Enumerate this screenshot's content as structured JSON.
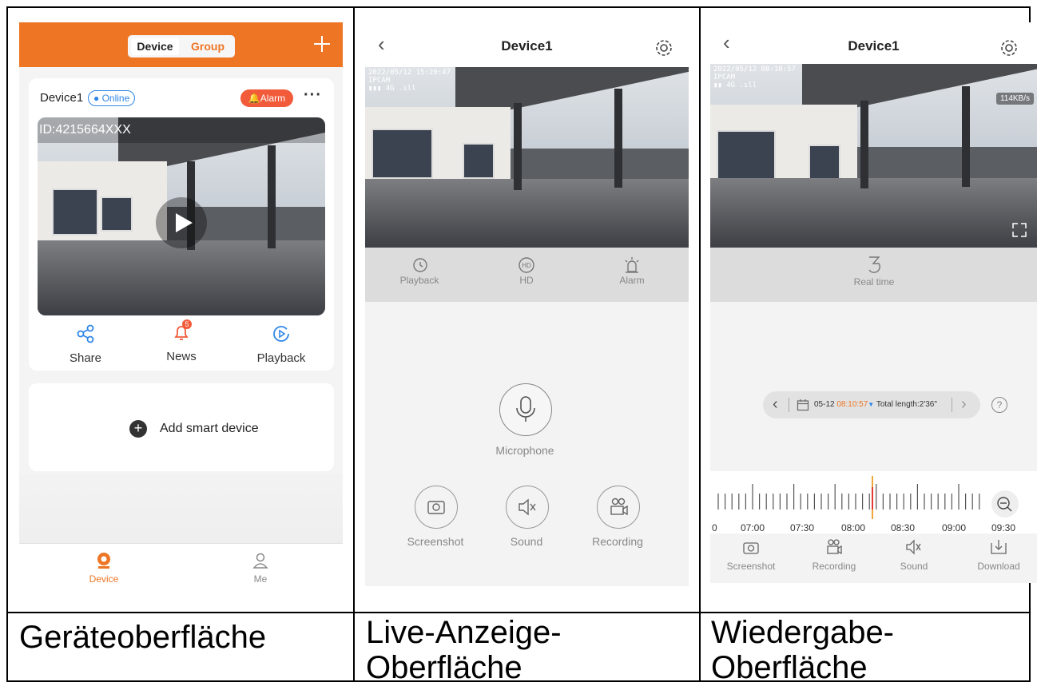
{
  "panel1": {
    "tabs": [
      "Device",
      "Group"
    ],
    "add_icon": "plus-icon",
    "device_name": "Device1",
    "status": "Online",
    "alarm_label": "Alarm",
    "more_icon": "more-icon",
    "device_id": "ID:4215664XXX",
    "actions": [
      {
        "label": "Share",
        "icon": "share-icon"
      },
      {
        "label": "News",
        "icon": "bell-icon",
        "badge": "5"
      },
      {
        "label": "Playback",
        "icon": "playback-icon"
      }
    ],
    "add_device_label": "Add smart device",
    "bottom_nav": [
      {
        "label": "Device",
        "icon": "camera-icon",
        "active": true
      },
      {
        "label": "Me",
        "icon": "user-icon",
        "active": false
      }
    ],
    "accent": "#ee7524"
  },
  "panel2": {
    "title": "Device1",
    "osd_time": "2022/05/12 15:20:47",
    "osd_name": "IPCAM",
    "osd_net": "4G",
    "controls": [
      {
        "label": "Playback",
        "icon": "history-icon"
      },
      {
        "label": "HD",
        "icon": "hd-icon"
      },
      {
        "label": "Alarm",
        "icon": "alarm-light-icon"
      }
    ],
    "microphone_label": "Microphone",
    "bottom": [
      {
        "label": "Screenshot",
        "icon": "camera-icon"
      },
      {
        "label": "Sound",
        "icon": "speaker-mute-icon"
      },
      {
        "label": "Recording",
        "icon": "video-record-icon"
      }
    ]
  },
  "panel3": {
    "title": "Device1",
    "osd_time": "2022/05/12 08:10:57",
    "osd_name": "IPCAM",
    "osd_net": "4G",
    "speed": "114KB/s",
    "realtime_label": "Real time",
    "date": "05-12",
    "time": "08:10:57",
    "total": "Total length:2'36\"",
    "help": "?",
    "timeline_labels": [
      "0",
      "07:00",
      "07:30",
      "08:00",
      "08:30",
      "09:00",
      "09:30"
    ],
    "bottom": [
      {
        "label": "Screenshot",
        "icon": "camera-icon"
      },
      {
        "label": "Recording",
        "icon": "video-record-icon"
      },
      {
        "label": "Sound",
        "icon": "speaker-mute-icon"
      },
      {
        "label": "Download",
        "icon": "download-icon"
      }
    ]
  },
  "captions": [
    "Geräteoberfläche",
    "Live-Anzeige-\nOberfläche",
    "Wiedergabe-\nOberfläche"
  ]
}
